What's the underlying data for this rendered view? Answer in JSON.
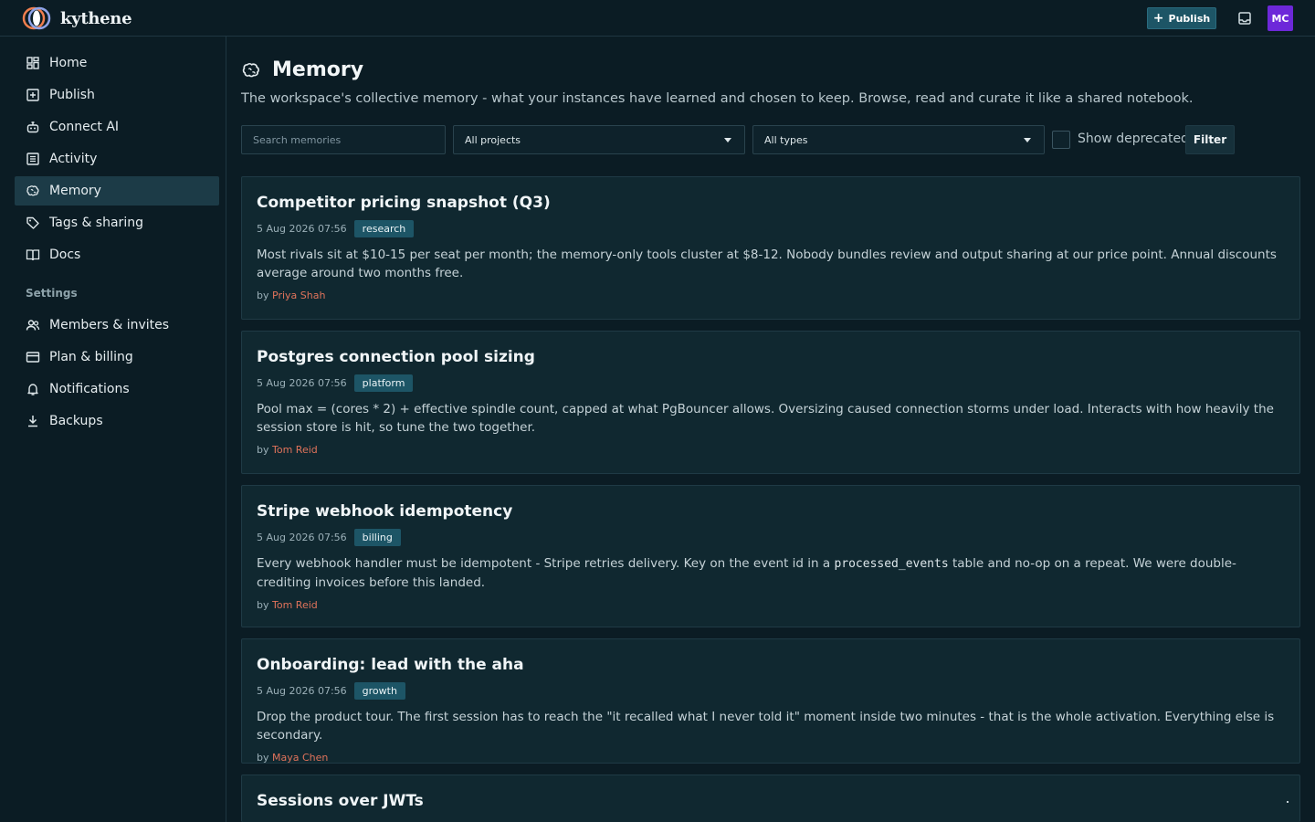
{
  "app": {
    "name": "kythene"
  },
  "header": {
    "publish_label": "Publish",
    "avatar_initials": "MC",
    "avatar_color": "#6d28d9",
    "accent_color": "#1d5566"
  },
  "sidebar": {
    "items": [
      {
        "label": "Home",
        "icon": "dashboard-icon"
      },
      {
        "label": "Publish",
        "icon": "plus-square-icon"
      },
      {
        "label": "Connect AI",
        "icon": "robot-icon"
      },
      {
        "label": "Activity",
        "icon": "list-icon"
      },
      {
        "label": "Memory",
        "icon": "brain-icon",
        "active": true
      },
      {
        "label": "Tags & sharing",
        "icon": "tag-icon"
      },
      {
        "label": "Docs",
        "icon": "book-icon"
      }
    ],
    "settings_heading": "Settings",
    "settings_items": [
      {
        "label": "Members & invites",
        "icon": "users-icon"
      },
      {
        "label": "Plan & billing",
        "icon": "credit-card-icon"
      },
      {
        "label": "Notifications",
        "icon": "bell-icon"
      },
      {
        "label": "Backups",
        "icon": "download-icon"
      }
    ]
  },
  "page": {
    "title": "Memory",
    "description": "The workspace's collective memory - what your instances have learned and chosen to keep. Browse, read and curate it like a shared notebook."
  },
  "filters": {
    "search_placeholder": "Search memories",
    "search_value": "",
    "project_selected": "All projects",
    "type_selected": "All types",
    "show_deprecated_label": "Show deprecated",
    "show_deprecated_checked": false,
    "filter_label": "Filter"
  },
  "memories": [
    {
      "title": "Competitor pricing snapshot (Q3)",
      "date": "5 Aug 2026 07:56",
      "tag": "research",
      "body": "Most rivals sit at $10-15 per seat per month; the memory-only tools cluster at $8-12. Nobody bundles review and output sharing at our price point. Annual discounts average around two months free.",
      "by": "by",
      "author": "Priya Shah"
    },
    {
      "title": "Postgres connection pool sizing",
      "date": "5 Aug 2026 07:56",
      "tag": "platform",
      "body": "Pool max = (cores * 2) + effective spindle count, capped at what PgBouncer allows. Oversizing caused connection storms under load. Interacts with how heavily the session store is hit, so tune the two together.",
      "by": "by",
      "author": "Tom Reid"
    },
    {
      "title": "Stripe webhook idempotency",
      "date": "5 Aug 2026 07:56",
      "tag": "billing",
      "body_before": "Every webhook handler must be idempotent - Stripe retries delivery. Key on the event id in a ",
      "body_code": "processed_events",
      "body_after": " table and no-op on a repeat. We were double-crediting invoices before this landed.",
      "by": "by",
      "author": "Tom Reid"
    },
    {
      "title": "Onboarding: lead with the aha",
      "date": "5 Aug 2026 07:56",
      "tag": "growth",
      "body": "Drop the product tour. The first session has to reach the \"it recalled what I never told it\" moment inside two minutes - that is the whole activation. Everything else is secondary.",
      "by": "by",
      "author": "Maya Chen"
    },
    {
      "title": "Sessions over JWTs"
    }
  ]
}
